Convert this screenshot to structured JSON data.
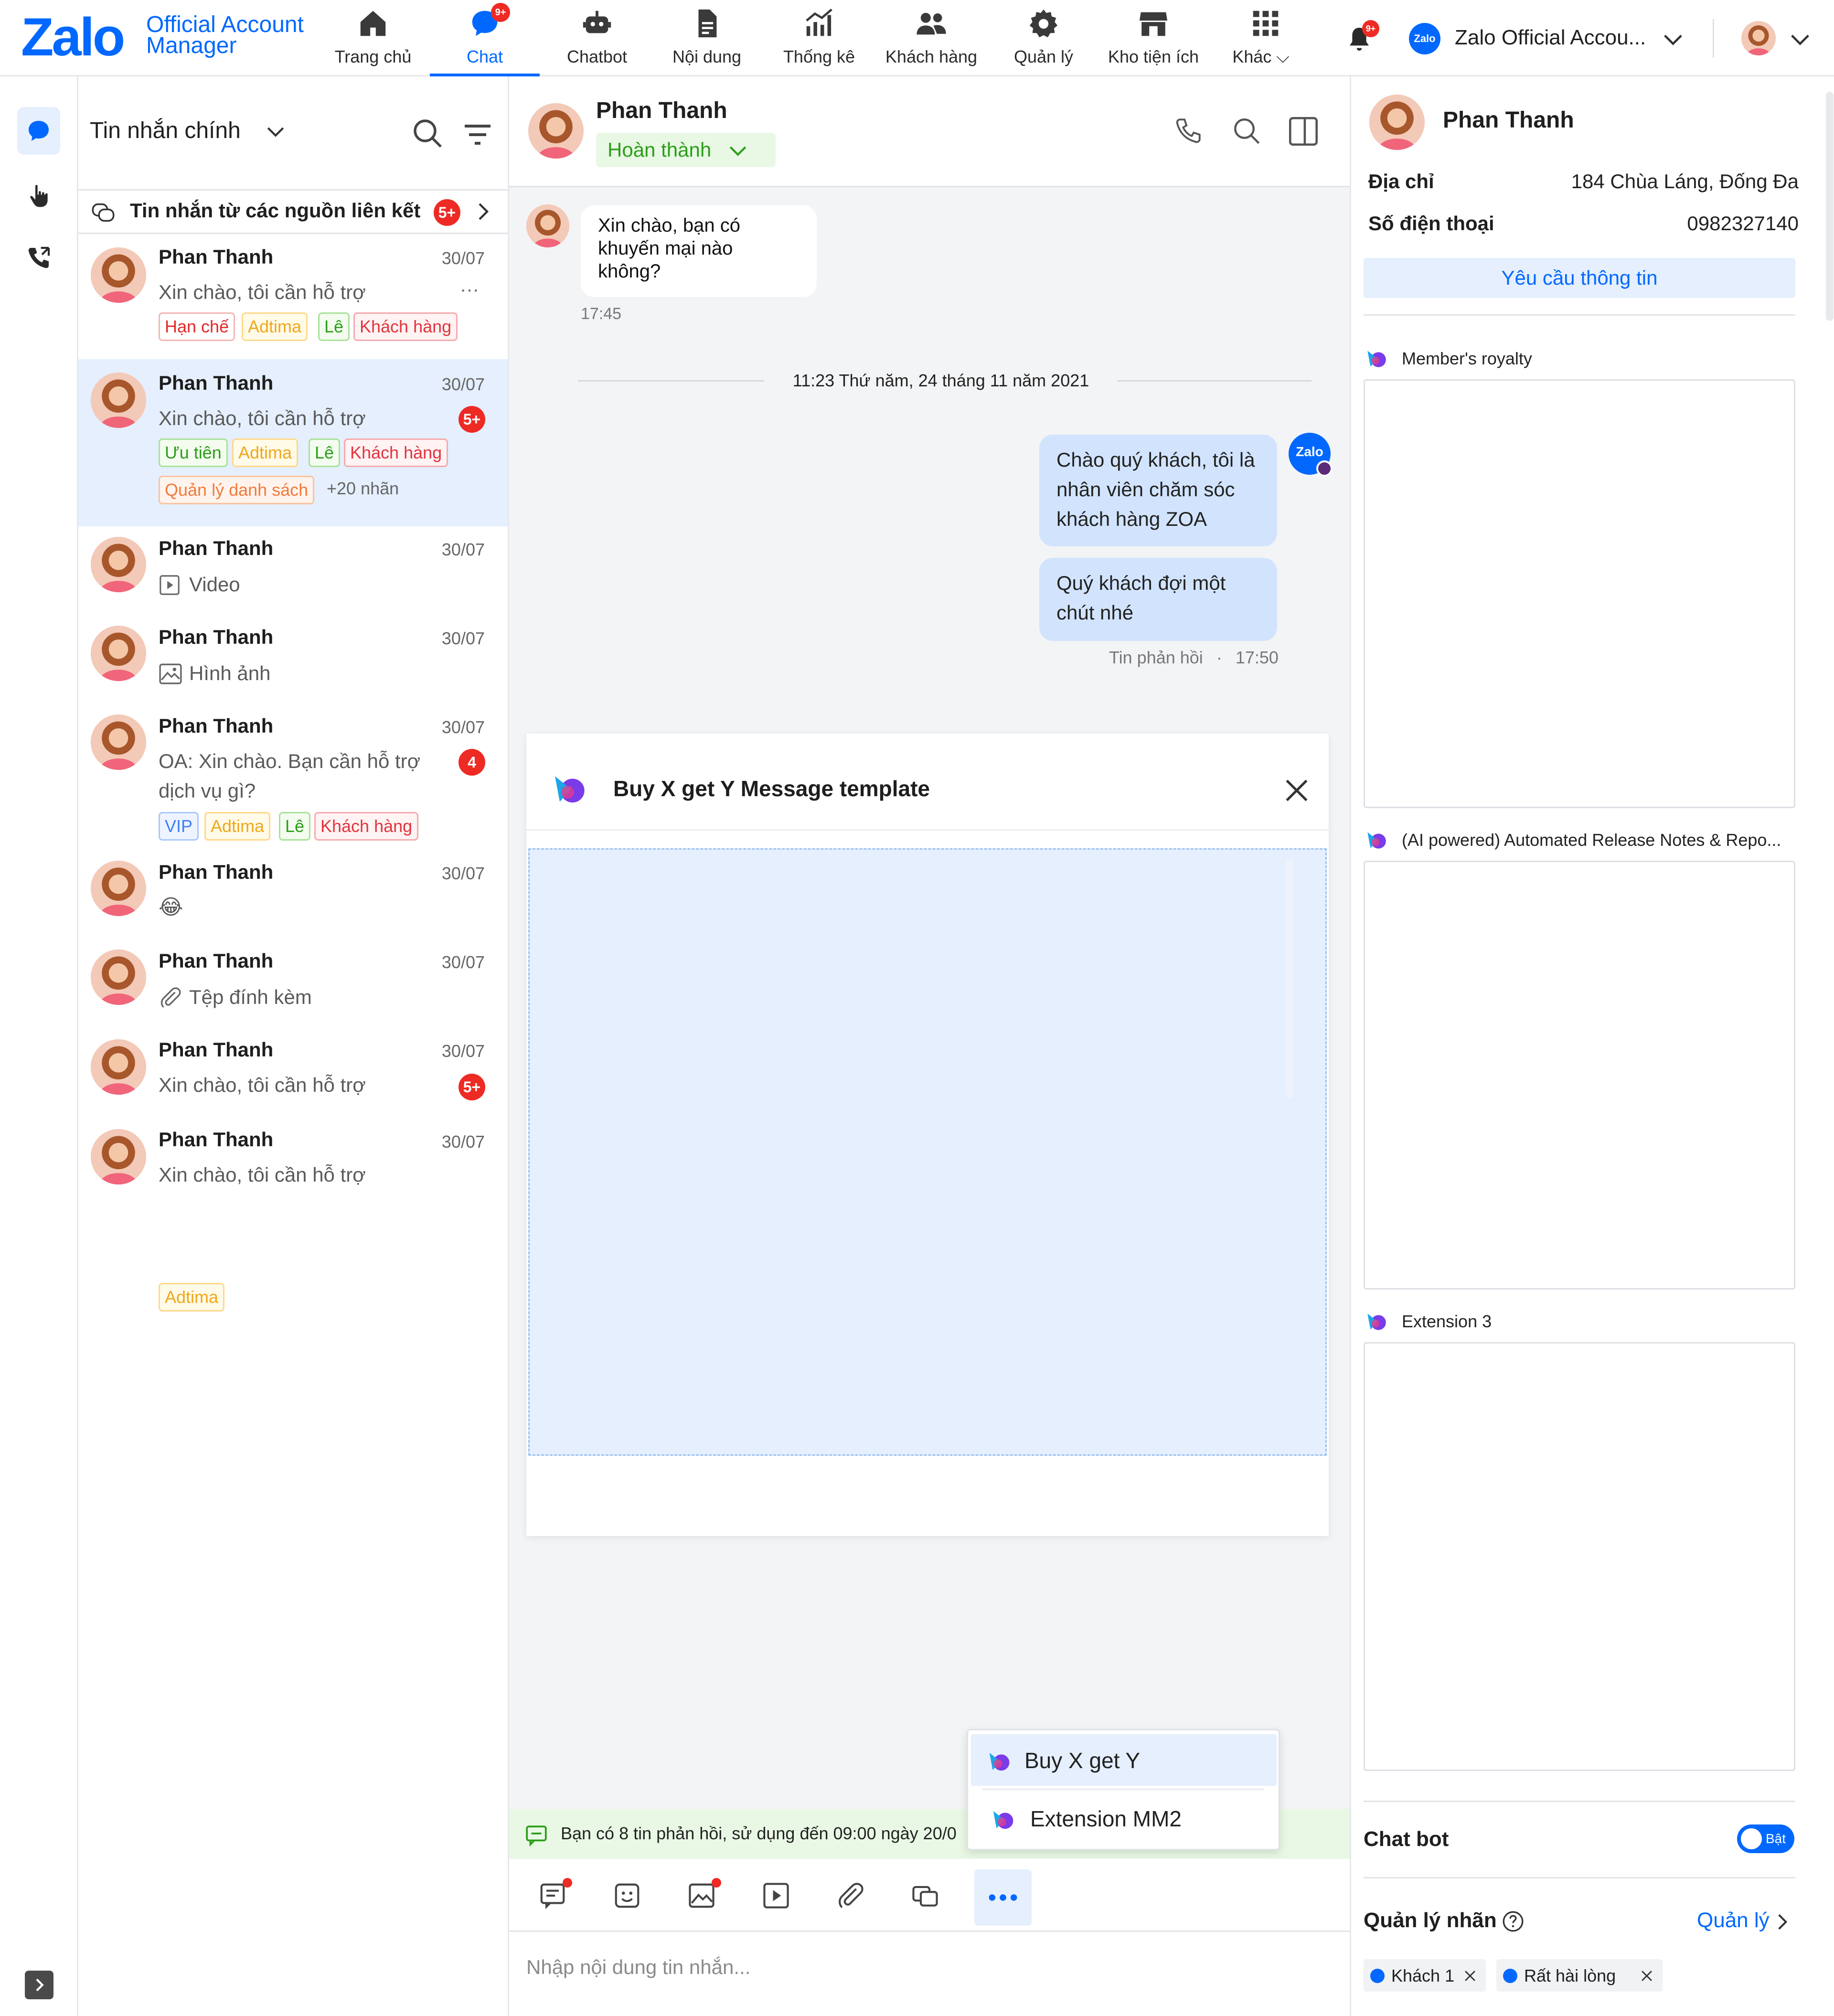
{
  "header": {
    "logo_main": "Zalo",
    "logo_sub_1": "Official Account",
    "logo_sub_2": "Manager",
    "nav": [
      {
        "label": "Trang chủ",
        "icon": "home-icon"
      },
      {
        "label": "Chat",
        "icon": "chat-icon",
        "badge": "9+"
      },
      {
        "label": "Chatbot",
        "icon": "robot-icon"
      },
      {
        "label": "Nội dung",
        "icon": "document-icon"
      },
      {
        "label": "Thống kê",
        "icon": "bar-chart-icon"
      },
      {
        "label": "Khách hàng",
        "icon": "users-icon"
      },
      {
        "label": "Quản lý",
        "icon": "gear-icon"
      },
      {
        "label": "Kho tiện ích",
        "icon": "store-icon"
      },
      {
        "label": "Khác",
        "icon": "grid-icon"
      }
    ],
    "notification_badge": "9+",
    "account_logo": "Zalo",
    "account_name": "Zalo Official Accou..."
  },
  "conversations": {
    "title": "Tin nhắn chính",
    "linked_sources_label": "Tin nhắn từ các nguồn liên kết",
    "linked_sources_badge": "5+",
    "items": [
      {
        "name": "Phan Thanh",
        "date": "30/07",
        "preview": "Xin chào, tôi cần hỗ trợ",
        "more": "···",
        "tags": [
          "Hạn chế",
          "Adtima",
          "Lê",
          "Khách hàng"
        ]
      },
      {
        "name": "Phan Thanh",
        "date": "30/07",
        "preview": "Xin chào, tôi cần hỗ trợ",
        "badge": "5+",
        "tags": [
          "Ưu tiên",
          "Adtima",
          "Lê",
          "Khách hàng",
          "Quản lý danh sách"
        ],
        "more_tags": "+20 nhãn"
      },
      {
        "name": "Phan Thanh",
        "date": "30/07",
        "preview": "Video"
      },
      {
        "name": "Phan Thanh",
        "date": "30/07",
        "preview": "Hình ảnh"
      },
      {
        "name": "Phan Thanh",
        "date": "30/07",
        "preview_1": "OA: Xin chào. Bạn cần hỗ trợ",
        "preview_2": "dịch vụ gì?",
        "badge": "4",
        "tags": [
          "VIP",
          "Adtima",
          "Lê",
          "Khách hàng"
        ]
      },
      {
        "name": "Phan Thanh",
        "date": "30/07",
        "preview": "😂"
      },
      {
        "name": "Phan Thanh",
        "date": "30/07",
        "preview": "Tệp đính kèm"
      },
      {
        "name": "Phan Thanh",
        "date": "30/07",
        "preview": "Xin chào, tôi cần hỗ trợ",
        "badge": "5+"
      },
      {
        "name": "Phan Thanh",
        "date": "30/07",
        "preview": "Xin chào, tôi cần hỗ trợ",
        "tags": [
          "Adtima"
        ]
      }
    ]
  },
  "chat": {
    "contact_name": "Phan Thanh",
    "status": "Hoàn thành",
    "incoming_message": [
      "Xin chào, bạn có",
      "khuyến mại nào",
      "không?"
    ],
    "incoming_time": "17:45",
    "date_divider": "11:23 Thứ năm, 24 tháng 11 năm 2021",
    "outgoing_1": [
      "Chào quý khách, tôi là",
      "nhân viên chăm sóc",
      "khách hàng ZOA"
    ],
    "outgoing_2": [
      "Quý khách đợi một",
      "chút nhé"
    ],
    "outgoing_meta": "Tin phản hồi",
    "outgoing_time": "17:50",
    "oa_avatar_text": "Zalo",
    "template_panel_title": "Buy X get Y Message template",
    "quota_notice": "Bạn có 8 tin phản hồi, sử dụng đến 09:00 ngày 20/0",
    "popup_items": [
      "Buy X get Y",
      "Extension MM2"
    ],
    "input_placeholder": "Nhập nội dung tin nhắn..."
  },
  "info": {
    "name": "Phan Thanh",
    "address_label": "Địa chỉ",
    "address_value": "184 Chùa Láng, Đống Đa",
    "phone_label": "Số điện thoại",
    "phone_value": "0982327140",
    "request_button": "Yêu cầu thông tin",
    "extensions": [
      "Member's royalty",
      "(AI powered) Automated Release Notes & Repo...",
      "Extension 3"
    ],
    "chatbot_label": "Chat bot",
    "chatbot_toggle": "Bật",
    "labels_title": "Quản lý nhãn",
    "labels_manage": "Quản lý",
    "labels": [
      "Khách 1",
      "Rất hài lòng"
    ]
  },
  "colors": {
    "brand": "#0068ff",
    "active_row": "#e5effd",
    "outgoing_bubble": "#d2e4fd",
    "badge": "#ee2a24",
    "status_green": "#2b9e18"
  }
}
